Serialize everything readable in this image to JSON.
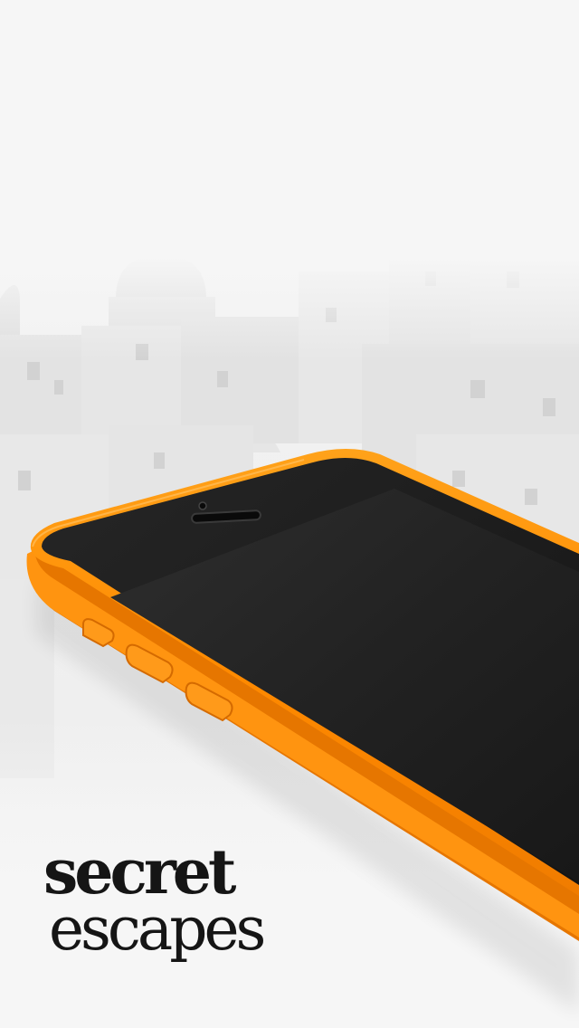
{
  "brand": {
    "logo_line1": "secret",
    "logo_line2": "escapes"
  },
  "colors": {
    "phone_body": "#ff8a00",
    "phone_body_shadow": "#e06f00",
    "screen_glass": "#1c1c1c",
    "background": "#f2f2f2",
    "logo_text": "#151515"
  },
  "icons": {
    "device": "orange-smartphone-icon",
    "background": "greek-island-buildings-photo"
  }
}
